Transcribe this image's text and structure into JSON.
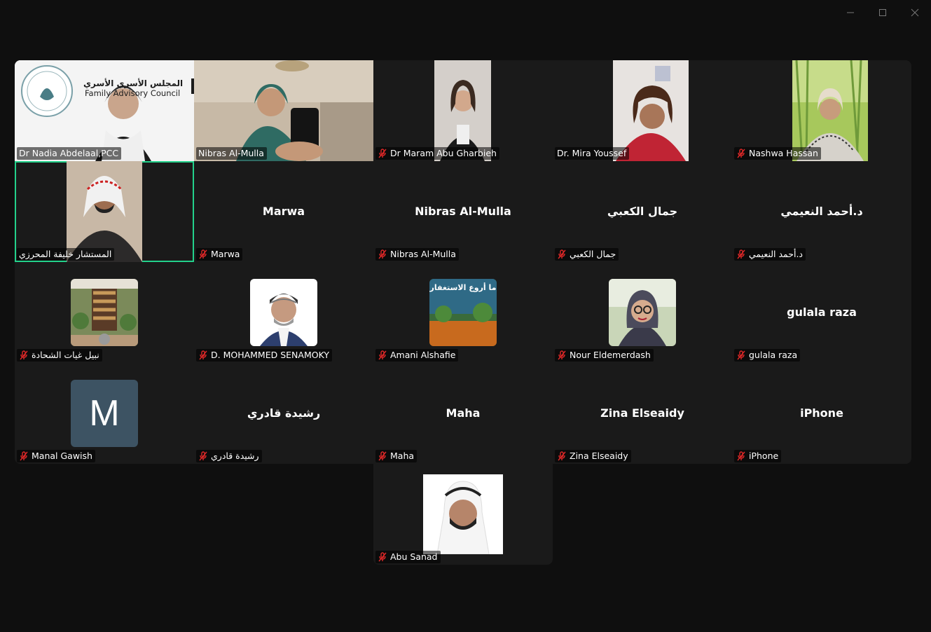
{
  "window": {
    "controls": [
      "minimize",
      "maximize",
      "close"
    ]
  },
  "participants": [
    {
      "name": "Dr Nadia Abdelaal,PCC",
      "muted": false,
      "video": true,
      "logo_text_ar": "المجلس الأسري الأسري",
      "logo_text_en": "Family Advisory Council"
    },
    {
      "name": "Nibras Al-Mulla",
      "muted": false,
      "video": true
    },
    {
      "name": "Dr Maram Abu Gharbieh",
      "muted": true,
      "video": true
    },
    {
      "name": "Dr. Mira Youssef",
      "muted": false,
      "video": true
    },
    {
      "name": "Nashwa Hassan",
      "muted": true,
      "video": true
    },
    {
      "name": "المستشار خليفة المحرزي",
      "muted": false,
      "video": true,
      "active": true
    },
    {
      "name": "Marwa",
      "display": "Marwa",
      "muted": true,
      "video": false
    },
    {
      "name": "Nibras Al-Mulla",
      "display": "Nibras Al-Mulla",
      "muted": true,
      "video": false
    },
    {
      "name": "جمال الكعبي",
      "display": "جمال الكعبي",
      "muted": true,
      "video": false
    },
    {
      "name": "د.أحمد النعيمي",
      "display": "د.أحمد النعيمي",
      "muted": true,
      "video": false
    },
    {
      "name": "نبيل غيات الشحادة",
      "muted": true,
      "avatar": "library-shelf-picture"
    },
    {
      "name": "D. MOHAMMED SENAMOKY",
      "muted": true,
      "avatar": "man-portrait"
    },
    {
      "name": "Amani Alshafie",
      "muted": true,
      "avatar": "istighfar-poster",
      "avatar_text": "ما أروع الاستغفار"
    },
    {
      "name": "Nour Eldemerdash",
      "muted": true,
      "avatar": "woman-portrait"
    },
    {
      "name": "gulala raza",
      "display": "gulala raza",
      "muted": true,
      "video": false
    },
    {
      "name": "Manal Gawish",
      "muted": true,
      "avatar": "letter",
      "avatar_letter": "M"
    },
    {
      "name": "رشيدة قادري",
      "display": "رشيدة قادري",
      "muted": true,
      "video": false
    },
    {
      "name": "Maha",
      "display": "Maha",
      "muted": true,
      "video": false
    },
    {
      "name": "Zina Elseaidy",
      "display": "Zina Elseaidy",
      "muted": true,
      "video": false
    },
    {
      "name": "iPhone",
      "display": "iPhone",
      "muted": true,
      "video": false
    },
    {
      "name": "Abu Sanad",
      "muted": true,
      "avatar": "man-portrait-ghutra"
    }
  ],
  "colors": {
    "background": "#0f0f0f",
    "tile": "#1a1a1a",
    "active_border": "#23d18b",
    "muted_icon": "#e02828",
    "letter_avatar": "#3d5363"
  }
}
